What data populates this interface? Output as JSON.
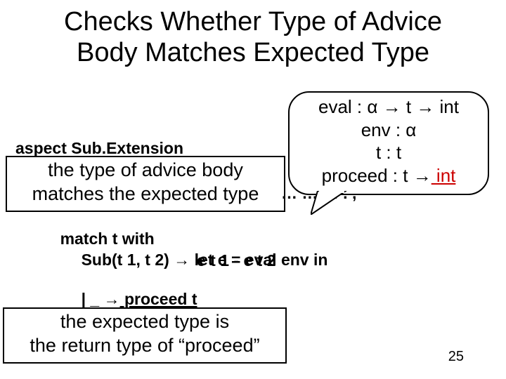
{
  "title_line1": "Checks Whether Type of Advice",
  "title_line2": "Body Matches Expected Type",
  "aspect_label": "aspect Sub.Extension",
  "note_type_line1": "the type of advice body",
  "note_type_line2": "matches the expected type",
  "note_proceed_line1": "the expected type is",
  "note_proceed_line2": "the return type of “proceed”",
  "bubble": {
    "l1_left": "eval : α ",
    "l1_arrow1": "→",
    "l1_mid": " t ",
    "l1_arrow2": "→",
    "l1_right": " int",
    "l2": "env : α",
    "l3": "t : t",
    "l4_left": "proceed : t ",
    "l4_arrow": "→",
    "l4_ret": " int"
  },
  "code": {
    "match": "match t with",
    "sub_left": "Sub(t 1, t 2) ",
    "sub_arrow": "→",
    "sub_right": " let e = eval env in",
    "sub2": "e t 1 - e t 2",
    "none_left": "| _ ",
    "none_arrow": "→",
    "none_right": " proceed t"
  },
  "garbage": "…  …  …  . ,",
  "page": "25"
}
